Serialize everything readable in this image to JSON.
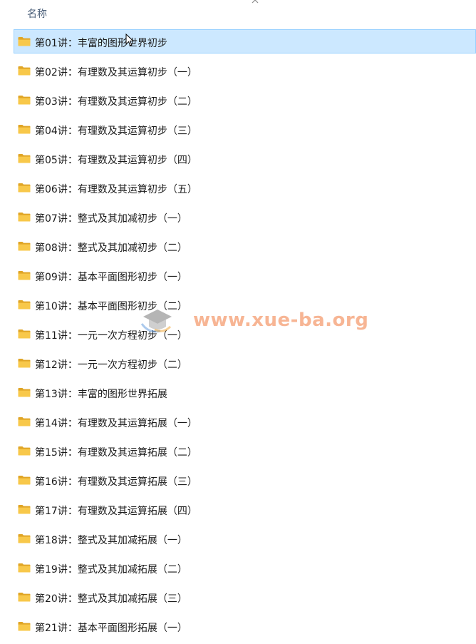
{
  "header": {
    "column_name": "名称",
    "sort_indicator_icon": "chevron-up-icon"
  },
  "files": [
    {
      "label": "第01讲：丰富的图形世界初步",
      "selected": true
    },
    {
      "label": "第02讲：有理数及其运算初步（一）"
    },
    {
      "label": "第03讲：有理数及其运算初步（二）"
    },
    {
      "label": "第04讲：有理数及其运算初步（三）"
    },
    {
      "label": "第05讲：有理数及其运算初步（四）"
    },
    {
      "label": "第06讲：有理数及其运算初步（五）"
    },
    {
      "label": "第07讲：整式及其加减初步（一）"
    },
    {
      "label": "第08讲：整式及其加减初步（二）"
    },
    {
      "label": "第09讲：基本平面图形初步（一）"
    },
    {
      "label": "第10讲：基本平面图形初步（二）"
    },
    {
      "label": "第11讲：一元一次方程初步（一）"
    },
    {
      "label": "第12讲：一元一次方程初步（二）"
    },
    {
      "label": "第13讲：丰富的图形世界拓展"
    },
    {
      "label": "第14讲：有理数及其运算拓展（一）"
    },
    {
      "label": "第15讲：有理数及其运算拓展（二）"
    },
    {
      "label": "第16讲：有理数及其运算拓展（三）"
    },
    {
      "label": "第17讲：有理数及其运算拓展（四）"
    },
    {
      "label": "第18讲：整式及其加减拓展（一）"
    },
    {
      "label": "第19讲：整式及其加减拓展（二）"
    },
    {
      "label": "第20讲：整式及其加减拓展（三）"
    },
    {
      "label": "第21讲：基本平面图形拓展（一）"
    }
  ],
  "watermark": {
    "text": "www.xue-ba.org"
  },
  "colors": {
    "selection_bg": "#cce8ff",
    "selection_border": "#99d1ff",
    "folder_yellow": "#f8c84a",
    "folder_dark": "#e0a526",
    "header_text": "#4c607a"
  }
}
